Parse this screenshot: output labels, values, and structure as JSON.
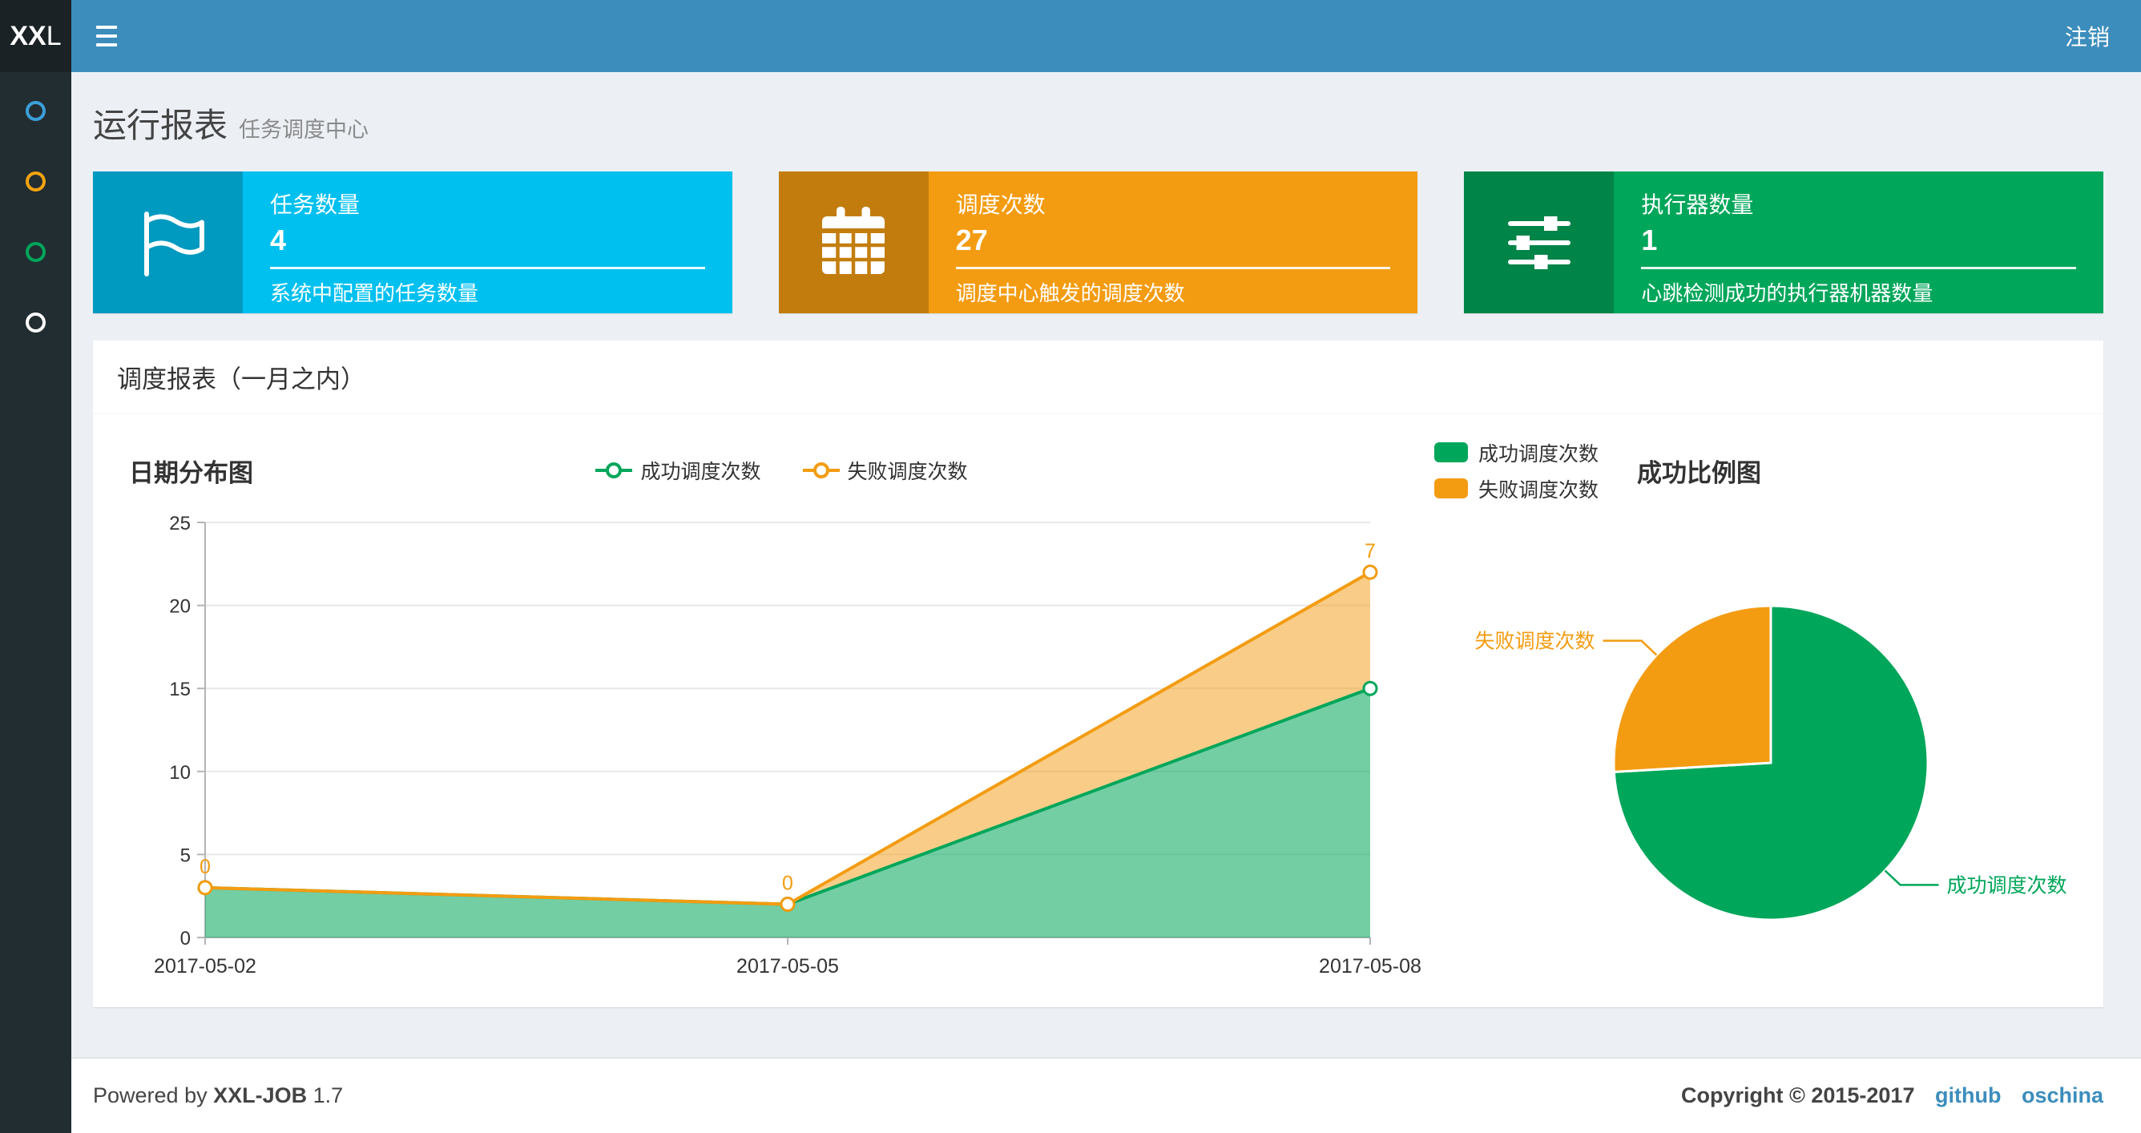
{
  "navbar": {
    "logo_bold": "XX",
    "logo_light": "L",
    "logout_label": "注销"
  },
  "sidebar": {
    "items": [
      {
        "name": "menu-item-1",
        "color": "#3c9fd8"
      },
      {
        "name": "menu-item-2",
        "color": "#f3a30f"
      },
      {
        "name": "menu-item-3",
        "color": "#00a65a"
      },
      {
        "name": "menu-item-4",
        "color": "#ffffff"
      }
    ]
  },
  "page": {
    "title": "运行报表",
    "subtitle": "任务调度中心"
  },
  "info_boxes": [
    {
      "label": "任务数量",
      "value": "4",
      "desc": "系统中配置的任务数量",
      "color": "#00c0ef",
      "icon": "flag-icon"
    },
    {
      "label": "调度次数",
      "value": "27",
      "desc": "调度中心触发的调度次数",
      "color": "#f39c12",
      "icon": "calendar-icon"
    },
    {
      "label": "执行器数量",
      "value": "1",
      "desc": "心跳检测成功的执行器机器数量",
      "color": "#00a65a",
      "icon": "sliders-icon"
    }
  ],
  "panel": {
    "title": "调度报表（一月之内）"
  },
  "chart_data": [
    {
      "type": "area",
      "title": "日期分布图",
      "x": [
        "2017-05-02",
        "2017-05-05",
        "2017-05-08"
      ],
      "series": [
        {
          "name": "成功调度次数",
          "values": [
            3,
            2,
            15
          ],
          "color": "#00a65a"
        },
        {
          "name": "失败调度次数",
          "values": [
            0,
            0,
            7
          ],
          "color": "#f39c12",
          "stacked": true,
          "point_labels": [
            "0",
            "0",
            "7"
          ]
        }
      ],
      "ylim": [
        0,
        25
      ],
      "yticks": [
        0,
        5,
        10,
        15,
        20,
        25
      ],
      "grid": true,
      "legend_position": "top-center"
    },
    {
      "type": "pie",
      "title": "成功比例图",
      "slices": [
        {
          "label": "成功调度次数",
          "value": 20,
          "color": "#00a65a"
        },
        {
          "label": "失败调度次数",
          "value": 7,
          "color": "#f39c12"
        }
      ],
      "legend_position": "top-left"
    }
  ],
  "footer": {
    "powered_prefix": "Powered by",
    "brand": "XXL-JOB",
    "version": "1.7",
    "copyright": "Copyright © 2015-2017",
    "links": [
      "github",
      "oschina"
    ]
  }
}
